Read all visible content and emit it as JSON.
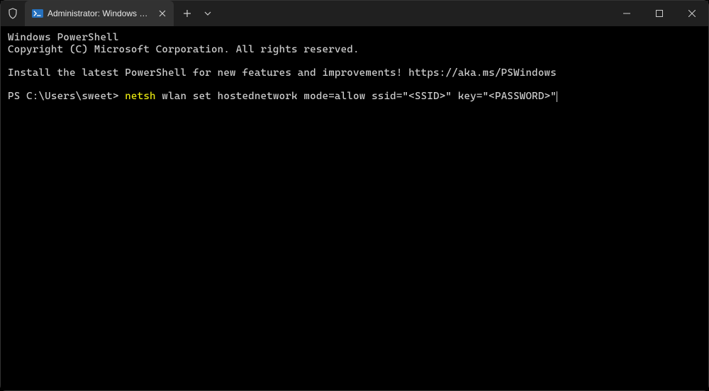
{
  "titlebar": {
    "tab": {
      "title": "Administrator: Windows Powe"
    }
  },
  "terminal": {
    "header1": "Windows PowerShell",
    "header2": "Copyright (C) Microsoft Corporation. All rights reserved.",
    "install_msg": "Install the latest PowerShell for new features and improvements! https://aka.ms/PSWindows",
    "prompt": "PS C:\\Users\\sweet> ",
    "command_highlight": "netsh",
    "command_rest": " wlan set hostednetwork mode=allow ssid=\"<SSID>\" key=\"<PASSWORD>\""
  }
}
